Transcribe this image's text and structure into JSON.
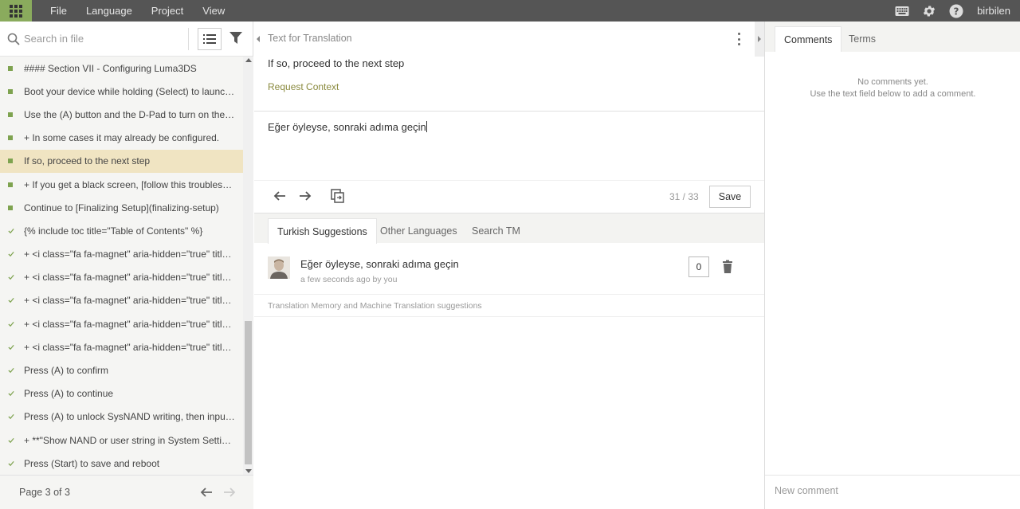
{
  "topbar": {
    "menu": [
      "File",
      "Language",
      "Project",
      "View"
    ],
    "username": "birbilen",
    "accent": "#8aab5d"
  },
  "left": {
    "search_placeholder": "Search in file",
    "strings": [
      {
        "text": "#### Section VII - Configuring Luma3DS",
        "status": "square",
        "active": false
      },
      {
        "text": "Boot your device while holding (Select) to launch t...",
        "status": "square",
        "active": false
      },
      {
        "text": "Use the (A) button and the D-Pad to turn on the fol...",
        "status": "square",
        "active": false
      },
      {
        "text": "+ In some cases it may already be configured.",
        "status": "square",
        "active": false
      },
      {
        "text": "If so, proceed to the next step",
        "status": "square",
        "active": true
      },
      {
        "text": "+ If you get a black screen, [follow this troubleshoo...",
        "status": "square",
        "active": false
      },
      {
        "text": "Continue to [Finalizing Setup](finalizing-setup)",
        "status": "square",
        "active": false
      },
      {
        "text": "{% include toc title=\"Table of Contents\" %}",
        "status": "check",
        "active": false
      },
      {
        "text": "+ <i class=\"fa fa-magnet\" aria-hidden=\"true\" title=\"...",
        "status": "check",
        "active": false
      },
      {
        "text": "+ <i class=\"fa fa-magnet\" aria-hidden=\"true\" title=\"...",
        "status": "check",
        "active": false
      },
      {
        "text": "+ <i class=\"fa fa-magnet\" aria-hidden=\"true\" title=\"...",
        "status": "check",
        "active": false
      },
      {
        "text": "+ <i class=\"fa fa-magnet\" aria-hidden=\"true\" title=\"...",
        "status": "check",
        "active": false
      },
      {
        "text": "+ <i class=\"fa fa-magnet\" aria-hidden=\"true\" title=\"...",
        "status": "check",
        "active": false
      },
      {
        "text": "Press (A) to confirm",
        "status": "check",
        "active": false
      },
      {
        "text": "Press (A) to continue",
        "status": "check",
        "active": false
      },
      {
        "text": "Press (A) to unlock SysNAND writing, then input th...",
        "status": "check",
        "active": false
      },
      {
        "text": "+ **\"Show NAND or user string in System Settings...",
        "status": "check",
        "active": false
      },
      {
        "text": "Press (Start) to save and reboot",
        "status": "check",
        "active": false
      }
    ],
    "page_label": "Page 3 of 3"
  },
  "editor": {
    "source_heading": "Text for Translation",
    "source_text": "If so, proceed to the next step",
    "request_context": "Request Context",
    "target_text": "Eğer öyleyse, sonraki adıma geçin",
    "counter": "31 / 33",
    "save_label": "Save"
  },
  "suggestions": {
    "tabs": [
      "Turkish Suggestions",
      "Other Languages",
      "Search TM"
    ],
    "item_text": "Eğer öyleyse, sonraki adıma geçin",
    "item_meta": "a few seconds ago by you",
    "votes": "0",
    "tm_label": "Translation Memory and Machine Translation suggestions"
  },
  "comments": {
    "tabs": [
      "Comments",
      "Terms"
    ],
    "empty_line1": "No comments yet.",
    "empty_line2": "Use the text field below to add a comment.",
    "new_placeholder": "New comment"
  }
}
